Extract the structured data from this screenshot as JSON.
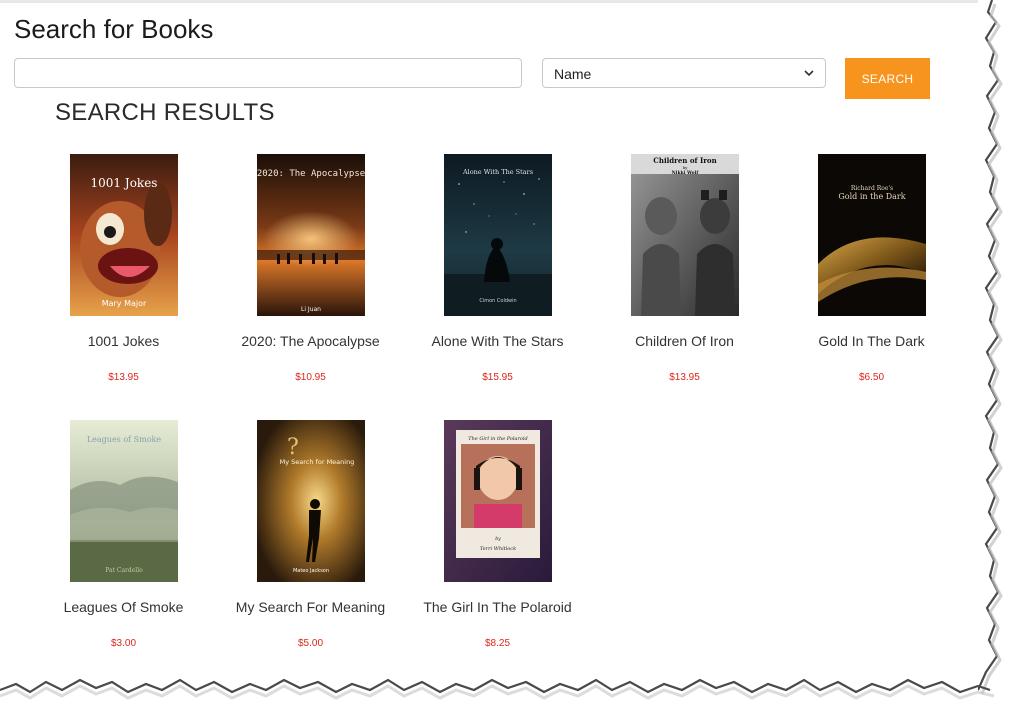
{
  "page": {
    "title": "Search for Books"
  },
  "search": {
    "value": "",
    "placeholder": "",
    "button_label": "SEARCH"
  },
  "filter": {
    "selected": "Name"
  },
  "results": {
    "heading": "SEARCH RESULTS",
    "books": [
      {
        "title": "1001 Jokes",
        "price": "$13.95",
        "cover_title": "1001 Jokes",
        "cover_author": "Mary Major"
      },
      {
        "title": "2020: The Apocalypse",
        "price": "$10.95",
        "cover_title": "2020: The Apocalypse",
        "cover_author": "Li Juan"
      },
      {
        "title": "Alone With The Stars",
        "price": "$15.95",
        "cover_title": "Alone With The Stars",
        "cover_author": "Cimon Coldwin"
      },
      {
        "title": "Children Of Iron",
        "price": "$13.95",
        "cover_title": "Children of Iron",
        "cover_by": "by",
        "cover_author": "Nikki Wolf"
      },
      {
        "title": "Gold In The Dark",
        "price": "$6.50",
        "cover_author": "Richard Roe's",
        "cover_title": "Gold in the Dark"
      },
      {
        "title": "Leagues Of Smoke",
        "price": "$3.00",
        "cover_title": "Leagues of Smoke",
        "cover_author": "Pat Cardello"
      },
      {
        "title": "My Search For Meaning",
        "price": "$5.00",
        "cover_title": "My Search for Meaning",
        "cover_author": "Mateo Jackson"
      },
      {
        "title": "The Girl In The Polaroid",
        "price": "$8.25",
        "cover_title": "The Girl in the Polaroid",
        "cover_by": "by",
        "cover_author": "Terri Whitlock"
      }
    ]
  },
  "colors": {
    "accent": "#f7941d",
    "price": "#e0241b",
    "text": "#333333"
  }
}
